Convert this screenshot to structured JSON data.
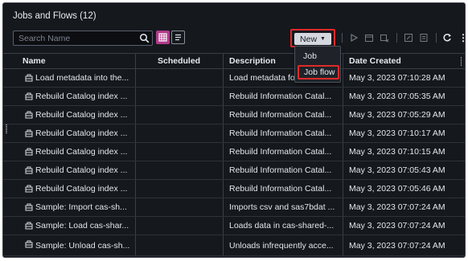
{
  "panel": {
    "title": "Jobs and Flows (12)"
  },
  "toolbar": {
    "search_placeholder": "Search Name",
    "new_label": "New",
    "icons": [
      "search-icon",
      "grid-view-icon",
      "list-view-icon",
      "run-icon",
      "schedule-icon",
      "delete-schedule-icon",
      "edit-icon",
      "properties-icon",
      "refresh-icon",
      "more-icon"
    ],
    "accent_color": "#b13a8a",
    "highlight_color": "#e02a2a"
  },
  "new_menu": {
    "items": [
      {
        "label": "Job"
      },
      {
        "label": "Job flow"
      }
    ]
  },
  "table": {
    "columns": [
      "Name",
      "Scheduled",
      "Description",
      "Date Created"
    ],
    "rows": [
      {
        "name": "Load metadata into the...",
        "scheduled": "",
        "description": "Load metadata fo",
        "date": "May 3, 2023 07:10:28 AM"
      },
      {
        "name": "Rebuild Catalog index ...",
        "scheduled": "",
        "description": "Rebuild Information Catal...",
        "date": "May 3, 2023 07:05:35 AM"
      },
      {
        "name": "Rebuild Catalog index ...",
        "scheduled": "",
        "description": "Rebuild Information Catal...",
        "date": "May 3, 2023 07:05:29 AM"
      },
      {
        "name": "Rebuild Catalog index ...",
        "scheduled": "",
        "description": "Rebuild Information Catal...",
        "date": "May 3, 2023 07:10:17 AM"
      },
      {
        "name": "Rebuild Catalog index ...",
        "scheduled": "",
        "description": "Rebuild Information Catal...",
        "date": "May 3, 2023 07:10:15 AM"
      },
      {
        "name": "Rebuild Catalog index ...",
        "scheduled": "",
        "description": "Rebuild Information Catal...",
        "date": "May 3, 2023 07:05:43 AM"
      },
      {
        "name": "Rebuild Catalog index ...",
        "scheduled": "",
        "description": "Rebuild Information Catal...",
        "date": "May 3, 2023 07:05:46 AM"
      },
      {
        "name": "Sample: Import cas-sh...",
        "scheduled": "",
        "description": "Imports csv and sas7bdat ...",
        "date": "May 3, 2023 07:07:24 AM"
      },
      {
        "name": "Sample: Load cas-shar...",
        "scheduled": "",
        "description": "Loads data in cas-shared-...",
        "date": "May 3, 2023 07:07:24 AM"
      },
      {
        "name": "Sample: Unload cas-sh...",
        "scheduled": "",
        "description": "Unloads infrequently acce...",
        "date": "May 3, 2023 07:07:24 AM"
      }
    ]
  }
}
